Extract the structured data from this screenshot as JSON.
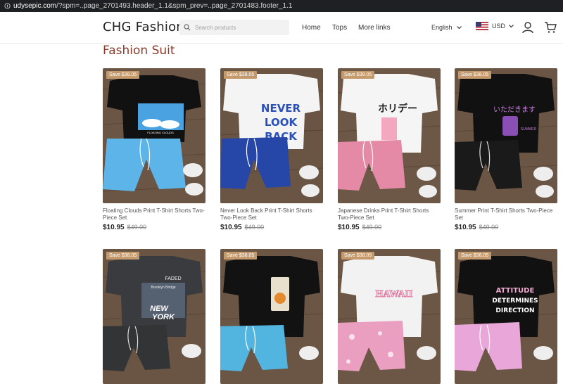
{
  "browser": {
    "url_host": "udysepic.com",
    "url_rest": "/?spm=..page_2701493.header_1.1&spm_prev=..page_2701483.footer_1.1"
  },
  "header": {
    "logo": "CHG Fashion",
    "search_placeholder": "Search products",
    "nav": [
      "Home",
      "Tops",
      "More links"
    ],
    "language": "English",
    "currency": "USD"
  },
  "section": {
    "title": "Fashion Suit"
  },
  "products": [
    {
      "badge": "Save $38.05",
      "name": "Floating Clouds Print T-Shirt Shorts Two-Piece Set",
      "price": "$10.95",
      "old_price": "$49.00"
    },
    {
      "badge": "Save $38.05",
      "name": "Never Look Back Print T-Shirt Shorts Two-Piece Set",
      "price": "$10.95",
      "old_price": "$49.00"
    },
    {
      "badge": "Save $38.05",
      "name": "Japanese Drinks Print T-Shirt Shorts Two-Piece Set",
      "price": "$10.95",
      "old_price": "$49.00"
    },
    {
      "badge": "Save $38.05",
      "name": "Summer Print T-Shirt Shorts Two-Piece Set",
      "price": "$10.95",
      "old_price": "$49.00"
    },
    {
      "badge": "Save $38.05"
    },
    {
      "badge": "Save $38.05"
    },
    {
      "badge": "Save $38.05"
    },
    {
      "badge": "Save $38.05"
    }
  ],
  "graphics": {
    "p1": "FLOATING CLOUDS",
    "p2a": "NEVER",
    "p2b": "LOOK",
    "p2c": "BACK",
    "p3": "ホリデー",
    "p4a": "いただきます",
    "p4b": "SUMMER",
    "p5a": "FADED",
    "p5b": "Brooklyn Bridge",
    "p5c": "NEW",
    "p5d": "YORK",
    "p7": "HAWAII",
    "p8a": "ATTITUDE",
    "p8b": "DETERMINES",
    "p8c": "DIRECTION"
  },
  "colors": {
    "accent": "#8b3a2e",
    "badge": "#c49a6c"
  }
}
